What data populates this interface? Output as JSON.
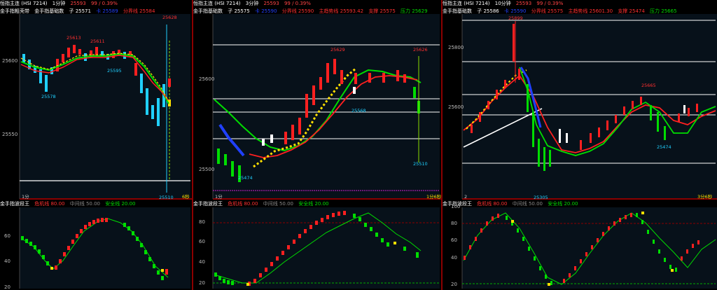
{
  "header": {
    "symbol": "恒指主连 (HSI 7214)",
    "price": "25593",
    "change": "99 / 0.39%"
  },
  "panels": [
    {
      "period": "1分钟",
      "indicator_name": "金手指粗壳带",
      "line_labels": [
        "金手指基础数",
        "子 25571",
        "卡 25589",
        "分界线 25584"
      ],
      "y_ticks": [
        "25600",
        "25550"
      ],
      "price_labels": [
        "25613",
        "25611",
        "25595",
        "25578",
        "25628",
        "25510"
      ],
      "bottom_left": "1分",
      "bottom_right": "6秒",
      "lower_title": [
        "金手指波段王",
        "危机线 80.00",
        "中间线 50.00",
        "安全线 20.00"
      ],
      "lower_y_ticks": [
        "60",
        "40",
        "20"
      ]
    },
    {
      "period": "3分钟",
      "indicator_name": "金手指基础数",
      "line_labels": [
        "子 25575",
        "卡 25590",
        "分界线 25590",
        "主趋势线 25593.42",
        "支撑 25575",
        "压力 25629"
      ],
      "y_ticks": [
        "25600",
        "25500"
      ],
      "price_labels": [
        "25629",
        "25626",
        "25568",
        "25510",
        "25474"
      ],
      "bottom_left": "1分",
      "bottom_right": "1分6秒",
      "lower_title": [
        "金手指波段王",
        "危机线 80.00",
        "中间线 50.00",
        "安全线 20.00"
      ],
      "lower_y_ticks": [
        "80",
        "60",
        "40",
        "20"
      ]
    },
    {
      "period": "10分钟",
      "indicator_name": "金手指基础数",
      "line_labels": [
        "子 25586",
        "卡 25590",
        "分界线 25575",
        "主趋势线 25601.30",
        "支撑 25474",
        "压力 25665"
      ],
      "y_ticks": [
        "25800",
        "25600"
      ],
      "price_labels": [
        "25899",
        "25665",
        "25474",
        "25305"
      ],
      "bottom_left": "2",
      "bottom_right": "3分6秒",
      "lower_title": [
        "金手指波段王",
        "危机线 80.00",
        "中间线 50.00",
        "安全线 20.00"
      ],
      "lower_y_ticks": [
        "100",
        "80",
        "60",
        "40",
        "20"
      ]
    }
  ],
  "colors": {
    "border": "#8b0000",
    "white": "#ffffff",
    "red": "#ff2020",
    "cyan": "#20d0ff",
    "yellow": "#ffe000",
    "green": "#00dd00",
    "blue": "#2040ff"
  }
}
